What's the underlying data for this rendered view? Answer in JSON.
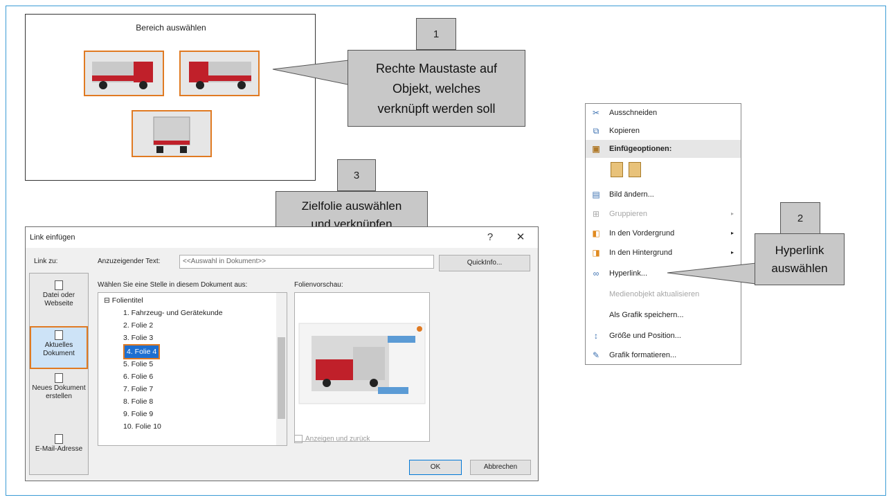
{
  "slide": {
    "title": "Bereich auswählen"
  },
  "callout1": {
    "number": "1",
    "text_lines": [
      "Rechte Maustaste auf",
      "Objekt, welches",
      "verknüpft werden soll"
    ]
  },
  "callout2": {
    "number": "2",
    "text_lines": [
      "Hyperlink",
      "auswählen"
    ]
  },
  "callout3": {
    "number": "3",
    "text_lines": [
      "Zielfolie auswählen",
      "und verknüpfen"
    ]
  },
  "dialog": {
    "title": "Link einfügen",
    "help": "?",
    "close": "✕",
    "link_to_label": "Link zu:",
    "display_text_label": "Anzuzeigender Text:",
    "display_text_value": "<<Auswahl in Dokument>>",
    "quickinfo_button": "QuickInfo...",
    "place_label": "Wählen Sie eine Stelle in diesem Dokument aus:",
    "preview_label": "Folienvorschau:",
    "link_items": [
      {
        "label": "Datei oder Webseite"
      },
      {
        "label": "Aktuelles Dokument"
      },
      {
        "label": "Neues Dokument erstellen"
      },
      {
        "label": "E-Mail-Adresse"
      }
    ],
    "tree_root": "Folientitel",
    "tree_items": [
      "1. Fahrzeug- und Gerätekunde",
      "2. Folie 2",
      "3. Folie 3",
      "4. Folie 4",
      "5. Folie 5",
      "6. Folie 6",
      "7. Folie 7",
      "8. Folie 8",
      "9. Folie 9",
      "10. Folie 10"
    ],
    "show_return": "Anzeigen und zurück",
    "ok_button": "OK",
    "cancel_button": "Abbrechen"
  },
  "context_menu": {
    "items": [
      {
        "label": "Ausschneiden",
        "icon": "scissors-icon",
        "disabled": false
      },
      {
        "label": "Kopieren",
        "icon": "copy-icon",
        "disabled": false
      },
      {
        "label": "Einfügeoptionen:",
        "icon": "paste-icon",
        "header": true
      },
      {
        "label": "Bild ändern...",
        "icon": "change-picture-icon",
        "disabled": false
      },
      {
        "label": "Gruppieren",
        "icon": "group-icon",
        "disabled": true,
        "submenu": true
      },
      {
        "label": "In den Vordergrund",
        "icon": "bring-forward-icon",
        "disabled": false,
        "submenu": true
      },
      {
        "label": "In den Hintergrund",
        "icon": "send-backward-icon",
        "disabled": false,
        "submenu": true
      },
      {
        "label": "Hyperlink...",
        "icon": "hyperlink-icon",
        "disabled": false
      },
      {
        "label": "Medienobjekt aktualisieren",
        "icon": "",
        "disabled": true
      },
      {
        "label": "Als Grafik speichern...",
        "icon": "",
        "disabled": false
      },
      {
        "label": "Größe und Position...",
        "icon": "size-position-icon",
        "disabled": false
      },
      {
        "label": "Grafik formatieren...",
        "icon": "format-picture-icon",
        "disabled": false
      }
    ]
  },
  "colors": {
    "accent_orange": "#e07a22",
    "callout_gray": "#c8c8c8",
    "selection_blue": "#1e6fd0"
  }
}
